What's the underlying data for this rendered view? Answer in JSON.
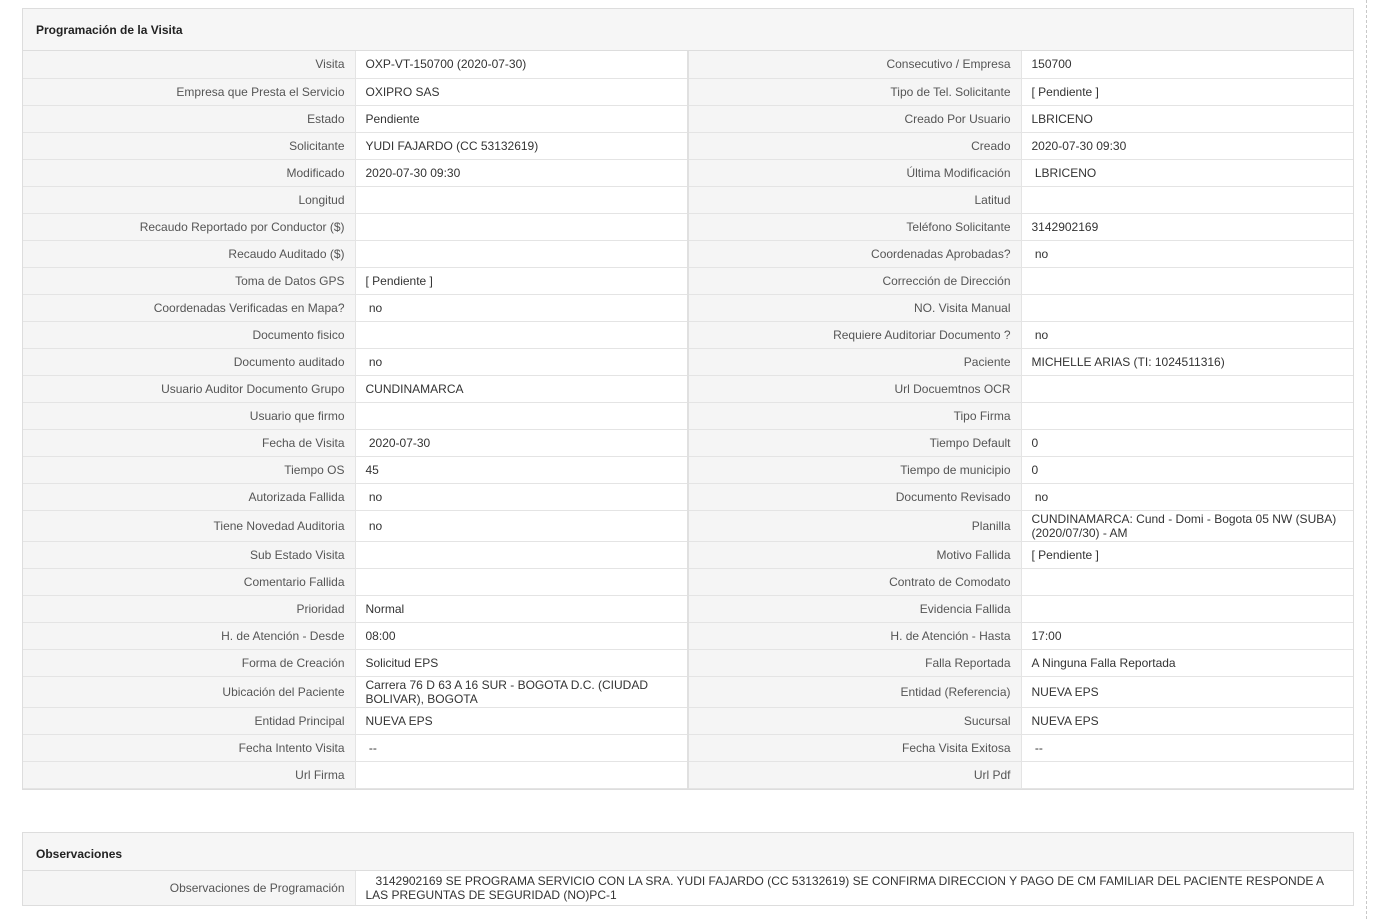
{
  "sections": {
    "programacion": {
      "title": "Programación de la Visita",
      "rows": [
        {
          "l1": "Visita",
          "v1": "OXP-VT-150700 (2020-07-30)",
          "l2": "Consecutivo / Empresa",
          "v2": "150700"
        },
        {
          "l1": "Empresa que Presta el Servicio",
          "v1": "OXIPRO SAS",
          "l2": "Tipo de Tel. Solicitante",
          "v2": "[ Pendiente ]"
        },
        {
          "l1": "Estado",
          "v1": "Pendiente",
          "l2": "Creado Por Usuario",
          "v2": "LBRICENO"
        },
        {
          "l1": "Solicitante",
          "v1": "YUDI FAJARDO (CC 53132619)",
          "l2": "Creado",
          "v2": "2020-07-30 09:30"
        },
        {
          "l1": "Modificado",
          "v1": "2020-07-30 09:30",
          "l2": "Última Modificación",
          "v2": " LBRICENO"
        },
        {
          "l1": "Longitud",
          "v1": "",
          "l2": "Latitud",
          "v2": ""
        },
        {
          "l1": "Recaudo Reportado por Conductor ($)",
          "v1": "",
          "l2": "Teléfono Solicitante",
          "v2": "3142902169"
        },
        {
          "l1": "Recaudo Auditado ($)",
          "v1": "",
          "l2": "Coordenadas Aprobadas?",
          "v2": " no"
        },
        {
          "l1": "Toma de Datos GPS",
          "v1": "[ Pendiente ]",
          "l2": "Corrección de Dirección",
          "v2": ""
        },
        {
          "l1": "Coordenadas Verificadas en Mapa?",
          "v1": " no",
          "l2": "NO. Visita Manual",
          "v2": ""
        },
        {
          "l1": "Documento fisico",
          "v1": "",
          "l2": "Requiere Auditoriar Documento ?",
          "v2": " no"
        },
        {
          "l1": "Documento auditado",
          "v1": " no",
          "l2": "Paciente",
          "v2": "MICHELLE ARIAS (TI: 1024511316)"
        },
        {
          "l1": "Usuario Auditor Documento Grupo",
          "v1": "CUNDINAMARCA",
          "l2": "Url Docuemtnos OCR",
          "v2": ""
        },
        {
          "l1": "Usuario que firmo",
          "v1": "",
          "l2": "Tipo Firma",
          "v2": ""
        },
        {
          "l1": "Fecha de Visita",
          "v1": " 2020-07-30",
          "l2": "Tiempo Default",
          "v2": "0"
        },
        {
          "l1": "Tiempo OS",
          "v1": "45",
          "l2": "Tiempo de municipio",
          "v2": "0"
        },
        {
          "l1": "Autorizada Fallida",
          "v1": " no",
          "l2": "Documento Revisado",
          "v2": " no"
        },
        {
          "l1": "Tiene Novedad Auditoria",
          "v1": " no",
          "l2": "Planilla",
          "v2": "CUNDINAMARCA: Cund - Domi - Bogota 05 NW (SUBA) (2020/07/30) - AM"
        },
        {
          "l1": "Sub Estado Visita",
          "v1": "",
          "l2": "Motivo Fallida",
          "v2": "[ Pendiente ]"
        },
        {
          "l1": "Comentario Fallida",
          "v1": "",
          "l2": "Contrato de Comodato",
          "v2": ""
        },
        {
          "l1": "Prioridad",
          "v1": "Normal",
          "l2": "Evidencia Fallida",
          "v2": ""
        },
        {
          "l1": "H. de Atención - Desde",
          "v1": "08:00",
          "l2": "H. de Atención - Hasta",
          "v2": "17:00"
        },
        {
          "l1": "Forma de Creación",
          "v1": "Solicitud EPS",
          "l2": "Falla Reportada",
          "v2": "A Ninguna Falla Reportada"
        },
        {
          "l1": "Ubicación del Paciente",
          "v1": "Carrera 76 D 63 A 16 SUR - BOGOTA D.C. (CIUDAD BOLIVAR), BOGOTA",
          "l2": "Entidad (Referencia)",
          "v2": "NUEVA EPS"
        },
        {
          "l1": "Entidad Principal",
          "v1": "NUEVA EPS",
          "l2": "Sucursal",
          "v2": "NUEVA EPS"
        },
        {
          "l1": "Fecha Intento Visita",
          "v1": " --",
          "l2": "Fecha Visita Exitosa",
          "v2": " --"
        },
        {
          "l1": "Url Firma",
          "v1": "",
          "l2": "Url Pdf",
          "v2": ""
        }
      ]
    },
    "observaciones": {
      "title": "Observaciones",
      "label": "Observaciones de Programación",
      "value": "   3142902169 SE PROGRAMA SERVICIO CON LA SRA. YUDI FAJARDO (CC 53132619) SE CONFIRMA DIRECCION Y PAGO DE CM FAMILIAR DEL PACIENTE RESPONDE A LAS PREGUNTAS DE SEGURIDAD (NO)PC-1"
    }
  }
}
